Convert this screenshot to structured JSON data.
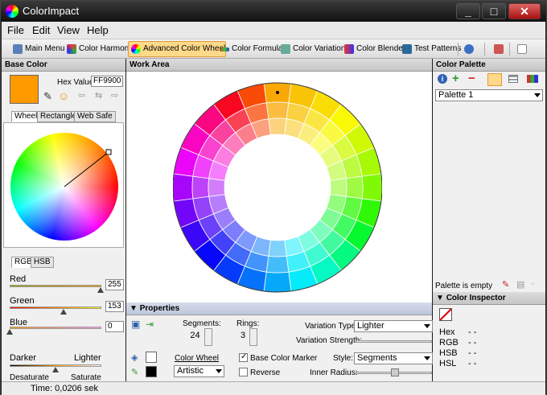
{
  "window": {
    "title": "ColorImpact"
  },
  "menu": [
    "File",
    "Edit",
    "View",
    "Help"
  ],
  "toolbar": {
    "items": [
      "Main Menu",
      "Color Harmonies",
      "Advanced Color Wheel",
      "Color Formulae",
      "Color Variations",
      "Color Blender",
      "Test Patterns"
    ],
    "active": "Advanced Color Wheel"
  },
  "base_color": {
    "header": "Base Color",
    "hex_label": "Hex Value",
    "hex_value": "FF9900",
    "swatch_color": "#FF9900",
    "tabs": [
      "Wheel",
      "Rectangle",
      "Web Safe"
    ],
    "mode_tabs": [
      "RGB",
      "HSB"
    ],
    "red_label": "Red",
    "red_value": "255",
    "green_label": "Green",
    "green_value": "153",
    "blue_label": "Blue",
    "blue_value": "0",
    "darker": "Darker",
    "lighter": "Lighter",
    "desaturate": "Desaturate",
    "saturate": "Saturate"
  },
  "work_area": {
    "header": "Work Area"
  },
  "properties": {
    "header": "Properties",
    "segments_label": "Segments:",
    "segments_value": "24",
    "rings_label": "Rings:",
    "rings_value": "3",
    "variation_type_label": "Variation Type:",
    "variation_type_value": "Lighter",
    "variation_strength_label": "Variation Strength:",
    "color_wheel_label": "Color Wheel",
    "color_wheel_value": "Artistic",
    "base_color_marker": "Base Color Marker",
    "reverse": "Reverse",
    "style_label": "Style:",
    "style_value": "Segments",
    "inner_radius_label": "Inner Radius:"
  },
  "color_palette": {
    "header": "Color Palette",
    "palette_name": "Palette 1",
    "status": "Palette is empty"
  },
  "inspector": {
    "header": "Color Inspector",
    "rows": [
      {
        "label": "Hex",
        "value": "- -"
      },
      {
        "label": "RGB",
        "value": "- -"
      },
      {
        "label": "HSB",
        "value": "- -"
      },
      {
        "label": "HSL",
        "value": "- -"
      }
    ]
  },
  "status": {
    "text": "Time: 0,0206 sek"
  },
  "icons": [
    "app-icon",
    "minimize-icon",
    "maximize-icon",
    "close-icon",
    "eyedropper-icon",
    "smiley-icon",
    "info-icon",
    "add-icon",
    "remove-icon",
    "save-icon",
    "export-icon",
    "help-icon"
  ]
}
